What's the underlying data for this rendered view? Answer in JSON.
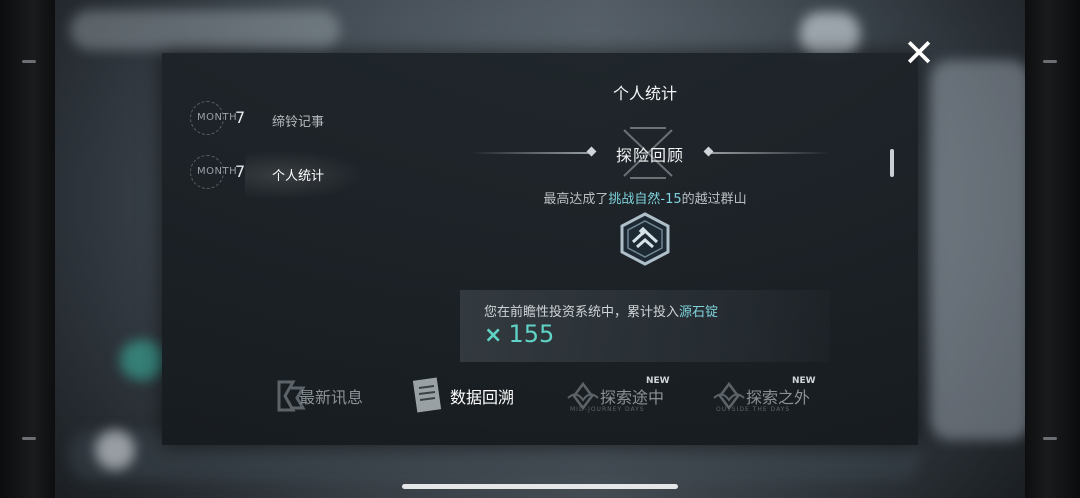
{
  "close_glyph": "✕",
  "list": [
    {
      "month_word": "MONTH",
      "month_num": "7",
      "label": "缔铃记事",
      "active": false
    },
    {
      "month_word": "MONTH",
      "month_num": "7",
      "label": "个人统计",
      "active": true
    }
  ],
  "content": {
    "title": "个人统计",
    "section": "探险回顾",
    "achieve_prefix": "最高达成了",
    "achieve_highlight": "挑战自然-15",
    "achieve_suffix": "的越过群山",
    "invest_prefix": "您在前瞻性投资系统中，累计投入",
    "invest_highlight": "源石锭",
    "invest_multiplier": "×",
    "invest_value": "155"
  },
  "tabs": [
    {
      "label": "最新讯息",
      "sub": "",
      "new": ""
    },
    {
      "label": "数据回溯",
      "sub": "",
      "new": ""
    },
    {
      "label": "探索途中",
      "sub": "MID-JOURNEY DAYS",
      "new": "NEW"
    },
    {
      "label": "探索之外",
      "sub": "OUTSIDE THE DAYS",
      "new": "NEW"
    }
  ],
  "colors": {
    "accent_teal": "#5fd3c6",
    "highlight_cyan": "#7fd3dc"
  }
}
